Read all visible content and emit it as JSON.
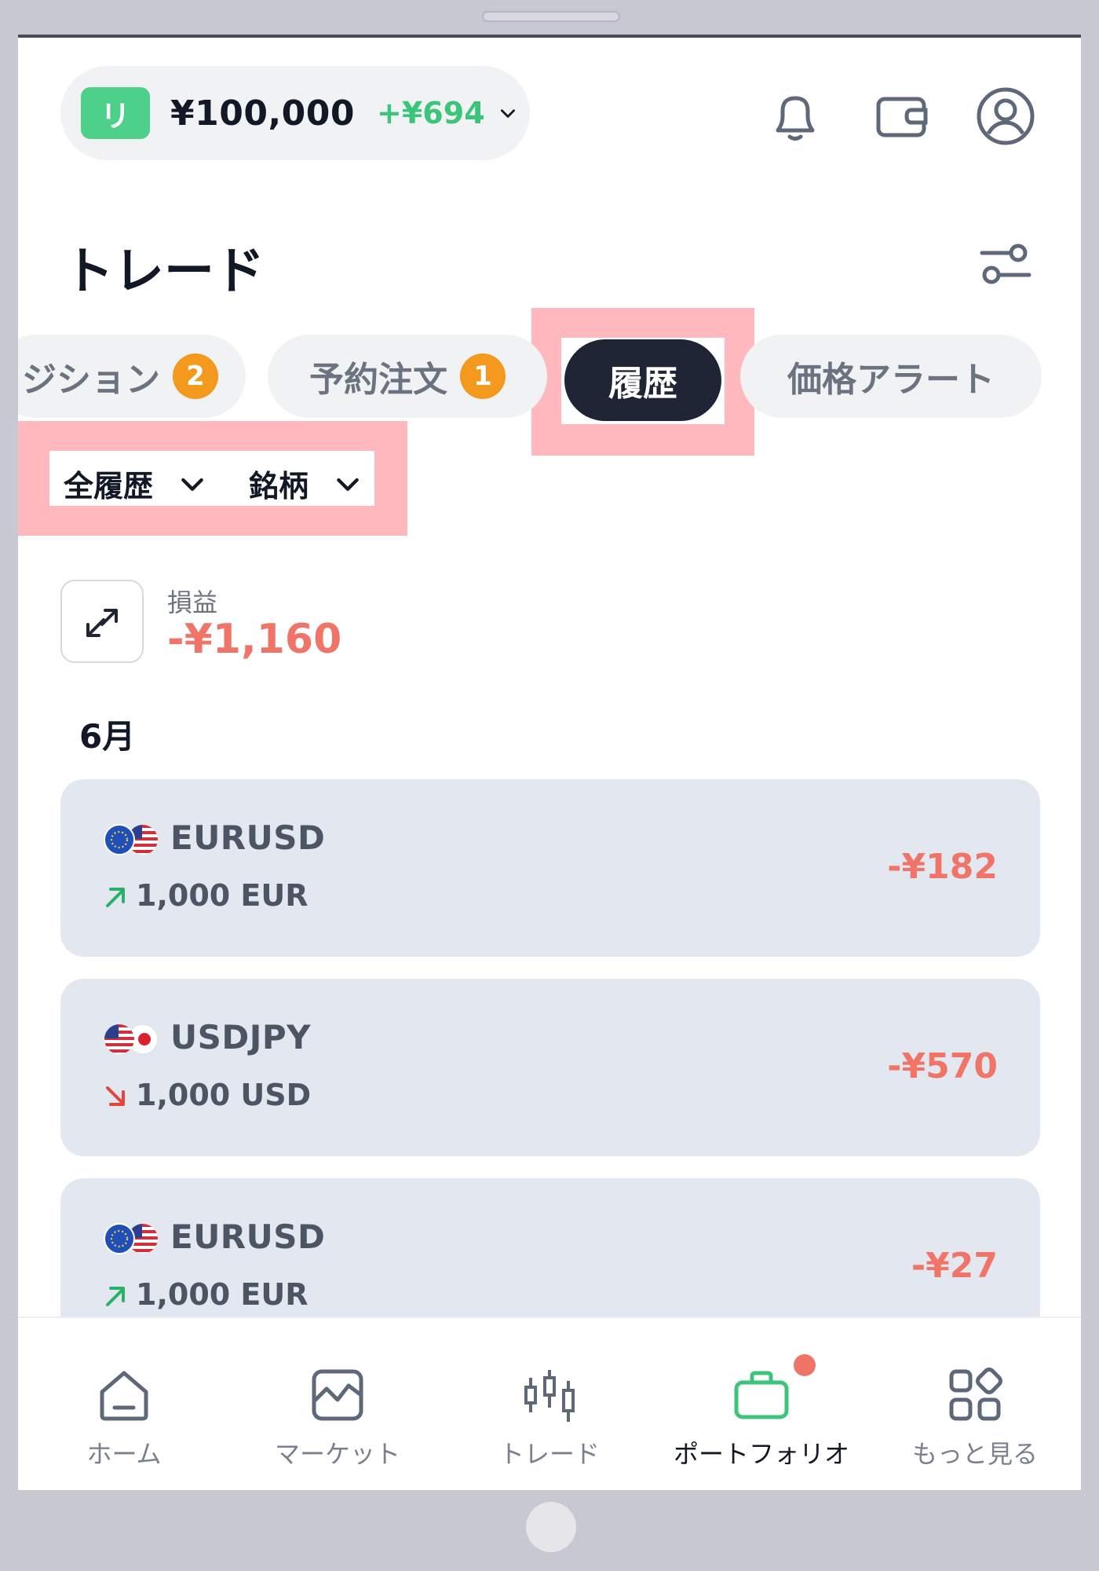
{
  "header": {
    "account_badge": "リ",
    "balance": "¥100,000",
    "balance_change": "+¥694"
  },
  "page": {
    "title": "トレード"
  },
  "tabs": [
    {
      "label": "ジション",
      "count": "2"
    },
    {
      "label": "予約注文",
      "count": "1"
    },
    {
      "label": "履歴"
    },
    {
      "label": "価格アラート"
    }
  ],
  "filters": {
    "history_type": "全履歴",
    "symbol": "銘柄"
  },
  "summary": {
    "label": "損益",
    "value": "-¥1,160"
  },
  "month": "6月",
  "trades": [
    {
      "symbol": "EURUSD",
      "quantity": "1,000 EUR",
      "direction": "buy",
      "profit": "-¥182"
    },
    {
      "symbol": "USDJPY",
      "quantity": "1,000 USD",
      "direction": "sell",
      "profit": "-¥570"
    },
    {
      "symbol": "EURUSD",
      "quantity": "1,000 EUR",
      "direction": "buy",
      "profit": "-¥27"
    }
  ],
  "nav": {
    "home": "ホーム",
    "market": "マーケット",
    "trade": "トレード",
    "portfolio": "ポートフォリオ",
    "more": "もっと見る"
  },
  "colors": {
    "accent_green": "#4cd08a",
    "loss_red": "#f07468",
    "badge_orange": "#f39a1e",
    "active_tab": "#1f2535",
    "highlight": "#ffb8bd"
  },
  "icons": {
    "bell": "bell-icon",
    "wallet": "wallet-icon",
    "profile": "user-icon",
    "filter": "sliders-icon",
    "pnl": "swap-arrows-icon"
  }
}
